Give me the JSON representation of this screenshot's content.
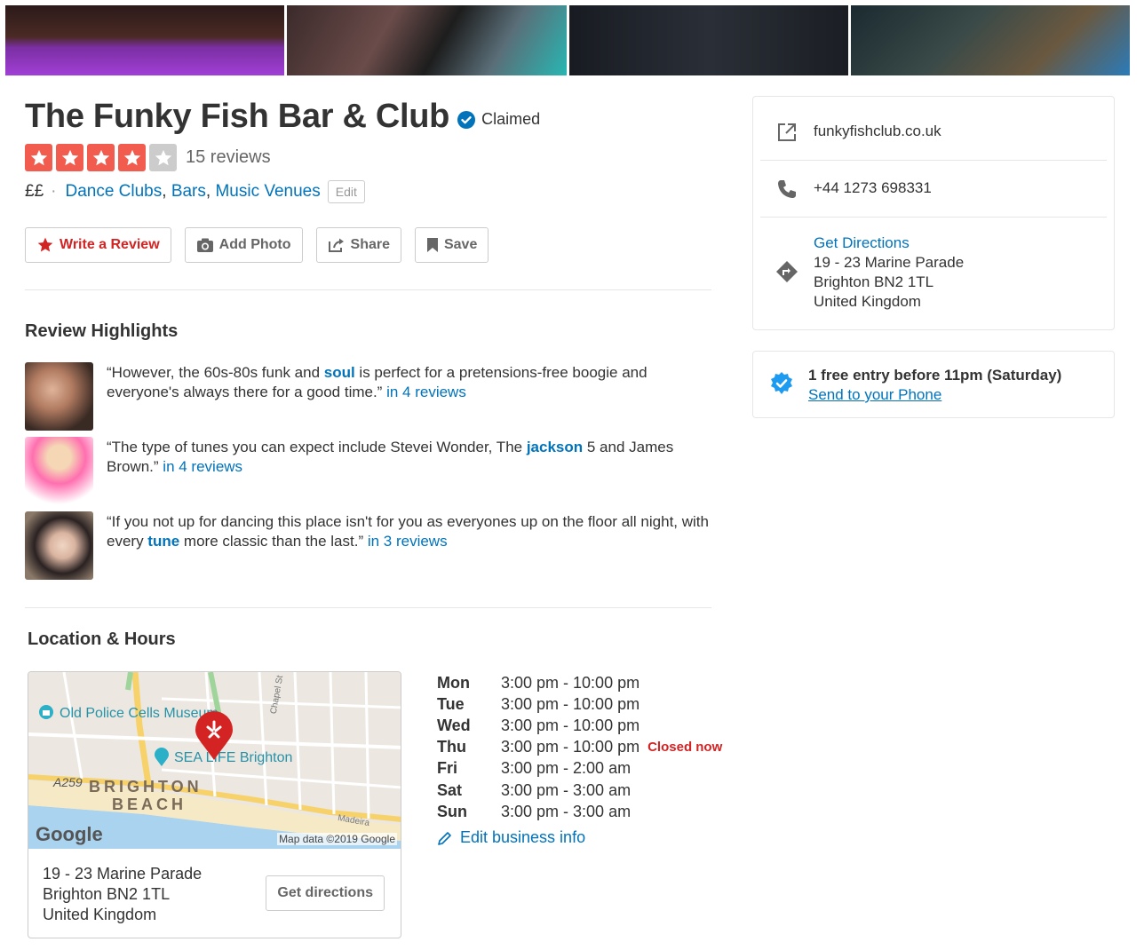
{
  "business": {
    "name": "The Funky Fish Bar & Club",
    "claimed_label": "Claimed",
    "rating": 4,
    "rating_max": 5,
    "reviews_label": "15 reviews",
    "price": "££",
    "categories": [
      "Dance Clubs",
      "Bars",
      "Music Venues"
    ],
    "edit_label": "Edit"
  },
  "actions": {
    "write_review": "Write a Review",
    "add_photo": "Add Photo",
    "share": "Share",
    "save": "Save"
  },
  "highlights": {
    "title": "Review Highlights",
    "items": [
      {
        "pre": "“However, the 60s-80s funk and ",
        "keyword": "soul",
        "post": " is perfect for a pretensions-free boogie and everyone's always there for a good time.” ",
        "count": "in 4 reviews"
      },
      {
        "pre": "“The type of tunes you can expect include Stevei Wonder, The ",
        "keyword": "jackson",
        "post": " 5 and James Brown.” ",
        "count": "in 4 reviews"
      },
      {
        "pre": "“If you not up for dancing this place isn't for you as everyones up on the floor all night, with every ",
        "keyword": "tune",
        "post": " more classic than the last.” ",
        "count": "in 3 reviews"
      }
    ]
  },
  "location": {
    "title": "Location & Hours",
    "address": [
      "19 - 23 Marine Parade",
      "Brighton BN2 1TL",
      "United Kingdom"
    ],
    "get_directions_button": "Get directions",
    "map": {
      "poi_police": "Old Police Cells Museum",
      "poi_sealife": "SEA LIFE Brighton",
      "road_a259": "A259",
      "area_line1": "BRIGHTON",
      "area_line2": "BEACH",
      "street_chapel": "Chapel St",
      "street_madeira": "Madeira",
      "google_logo": "Google",
      "attribution": "Map data ©2019 Google"
    }
  },
  "hours": {
    "rows": [
      {
        "day": "Mon",
        "time": "3:00 pm - 10:00 pm",
        "status": ""
      },
      {
        "day": "Tue",
        "time": "3:00 pm - 10:00 pm",
        "status": ""
      },
      {
        "day": "Wed",
        "time": "3:00 pm - 10:00 pm",
        "status": ""
      },
      {
        "day": "Thu",
        "time": "3:00 pm - 10:00 pm",
        "status": "Closed now"
      },
      {
        "day": "Fri",
        "time": "3:00 pm - 2:00 am",
        "status": ""
      },
      {
        "day": "Sat",
        "time": "3:00 pm - 3:00 am",
        "status": ""
      },
      {
        "day": "Sun",
        "time": "3:00 pm - 3:00 am",
        "status": ""
      }
    ],
    "edit_label": "Edit business info"
  },
  "sidebar": {
    "website": "funkyfishclub.co.uk",
    "phone": "+44 1273 698331",
    "directions_link": "Get Directions",
    "address": [
      "19 - 23 Marine Parade",
      "Brighton BN2 1TL",
      "United Kingdom"
    ]
  },
  "deal": {
    "title": "1 free entry before 11pm (Saturday)",
    "link": "Send to your Phone"
  },
  "colors": {
    "brand_red": "#d32323",
    "star_red": "#f15c4f",
    "link_blue": "#0073bb"
  }
}
